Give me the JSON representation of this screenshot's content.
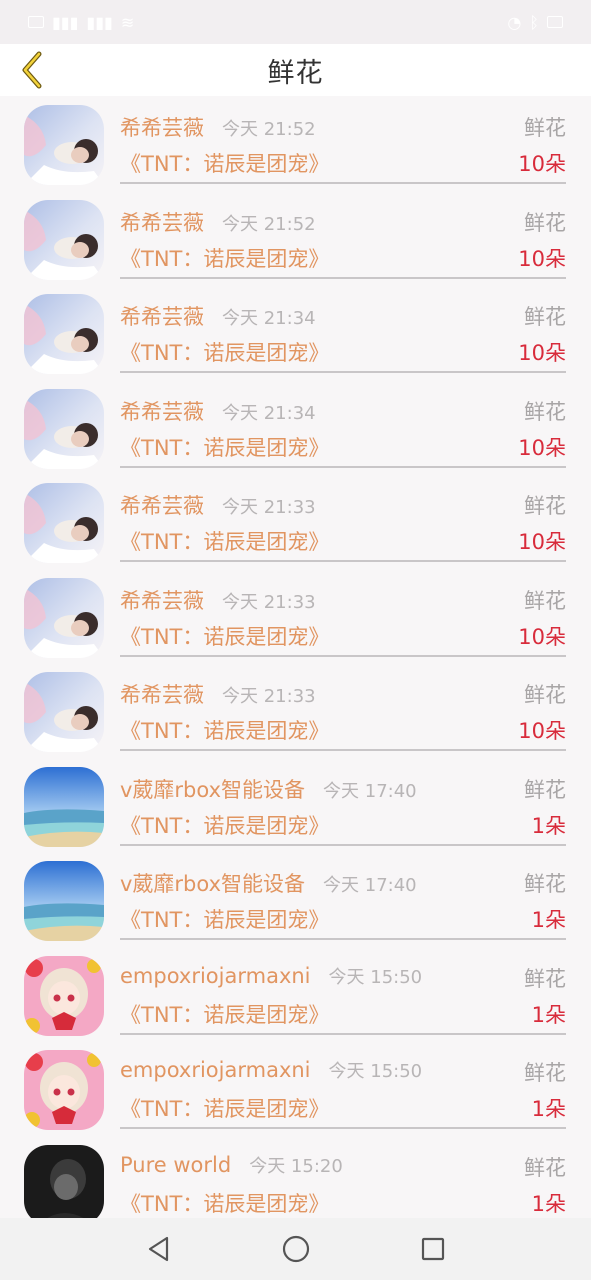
{
  "status_bar": {
    "left_icons": [
      "sim-icon",
      "signal-icon",
      "signal-icon",
      "wifi-icon"
    ],
    "right_text": "",
    "right_icons": [
      "alarm-icon",
      "bluetooth-icon",
      "battery-icon"
    ]
  },
  "header": {
    "title": "鲜花",
    "back_icon": "chevron-left-icon"
  },
  "rows": [
    {
      "name": "希希芸薇",
      "time": "今天 21:52",
      "type": "鲜花",
      "title": "《TNT：诺辰是团宠》",
      "count": "10朵",
      "avatar": "portrait"
    },
    {
      "name": "希希芸薇",
      "time": "今天 21:52",
      "type": "鲜花",
      "title": "《TNT：诺辰是团宠》",
      "count": "10朵",
      "avatar": "portrait"
    },
    {
      "name": "希希芸薇",
      "time": "今天 21:34",
      "type": "鲜花",
      "title": "《TNT：诺辰是团宠》",
      "count": "10朵",
      "avatar": "portrait"
    },
    {
      "name": "希希芸薇",
      "time": "今天 21:34",
      "type": "鲜花",
      "title": "《TNT：诺辰是团宠》",
      "count": "10朵",
      "avatar": "portrait"
    },
    {
      "name": "希希芸薇",
      "time": "今天 21:33",
      "type": "鲜花",
      "title": "《TNT：诺辰是团宠》",
      "count": "10朵",
      "avatar": "portrait"
    },
    {
      "name": "希希芸薇",
      "time": "今天 21:33",
      "type": "鲜花",
      "title": "《TNT：诺辰是团宠》",
      "count": "10朵",
      "avatar": "portrait"
    },
    {
      "name": "希希芸薇",
      "time": "今天 21:33",
      "type": "鲜花",
      "title": "《TNT：诺辰是团宠》",
      "count": "10朵",
      "avatar": "portrait"
    },
    {
      "name": "v葳靡rbox智能设备",
      "time": "今天 17:40",
      "type": "鲜花",
      "title": "《TNT：诺辰是团宠》",
      "count": "1朵",
      "avatar": "sea"
    },
    {
      "name": "v葳靡rbox智能设备",
      "time": "今天 17:40",
      "type": "鲜花",
      "title": "《TNT：诺辰是团宠》",
      "count": "1朵",
      "avatar": "sea"
    },
    {
      "name": "empoxriojarmaxni",
      "time": "今天 15:50",
      "type": "鲜花",
      "title": "《TNT：诺辰是团宠》",
      "count": "1朵",
      "avatar": "anime"
    },
    {
      "name": "empoxriojarmaxni",
      "time": "今天 15:50",
      "type": "鲜花",
      "title": "《TNT：诺辰是团宠》",
      "count": "1朵",
      "avatar": "anime"
    },
    {
      "name": "Pure world",
      "time": "今天 15:20",
      "type": "鲜花",
      "title": "《TNT：诺辰是团宠》",
      "count": "1朵",
      "avatar": "dark"
    }
  ],
  "nav_bar": {
    "back_icon": "triangle-back-icon",
    "home_icon": "circle-home-icon",
    "recents_icon": "square-recents-icon"
  },
  "colors": {
    "accent": "#e19561",
    "count": "#d82b3b",
    "muted": "#a8a5a6",
    "back_arrow": "#a78a1f"
  }
}
